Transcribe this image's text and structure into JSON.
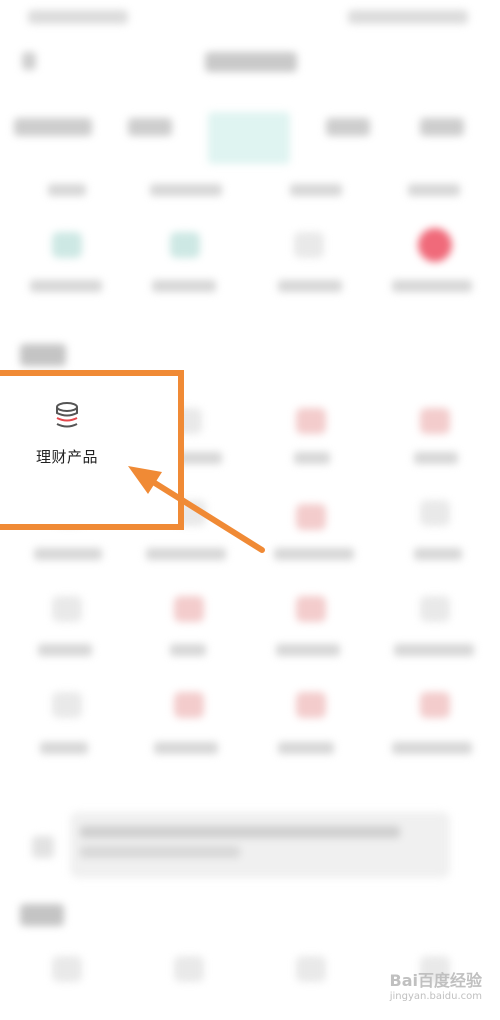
{
  "highlight": {
    "item_label": "理财产品",
    "item_icon": "coin-stack-icon"
  },
  "watermark": {
    "brand": "Bai百度经验",
    "url": "jingyan.baidu.com"
  },
  "colors": {
    "highlight_border": "#f08a35",
    "arrow": "#f08a35",
    "icon_stroke": "#555555",
    "icon_accent": "#e5484d"
  }
}
